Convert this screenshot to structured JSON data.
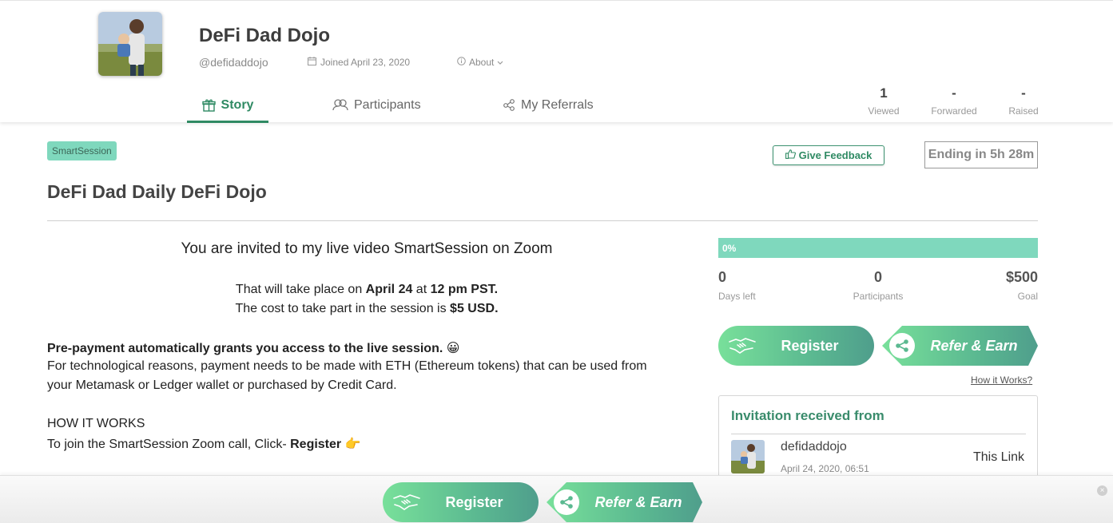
{
  "profile": {
    "name": "DeFi Dad Dojo",
    "handle": "@defidaddojo",
    "joined": "Joined April 23, 2020",
    "about": "About"
  },
  "tabs": [
    {
      "label": "Story",
      "icon": "gift-icon",
      "active": true
    },
    {
      "label": "Participants",
      "icon": "people-icon",
      "active": false
    },
    {
      "label": "My Referrals",
      "icon": "share-nodes-icon",
      "active": false
    }
  ],
  "stats": [
    {
      "value": "1",
      "label": "Viewed"
    },
    {
      "value": "-",
      "label": "Forwarded"
    },
    {
      "value": "-",
      "label": "Raised"
    }
  ],
  "session": {
    "badge": "SmartSession",
    "feedback_label": "Give Feedback",
    "ending": "Ending in 5h 28m",
    "title": "DeFi Dad Daily DeFi Dojo"
  },
  "story": {
    "heading": "You are invited to my live video SmartSession on Zoom",
    "line1_a": "That will take place on ",
    "line1_b": "April 24",
    "line1_c": " at ",
    "line1_d": "12 pm PST.",
    "line2_a": "The cost to take part in the session is ",
    "line2_b": "$5 USD.",
    "prepay": "Pre-payment automatically grants you access to the live session.",
    "prepay_emoji": "😀",
    "tech1": "For technological reasons, payment needs to be made with ETH (Ethereum tokens) that can be used from",
    "tech2": "your Metamask or Ledger wallet or purchased by Credit Card.",
    "how_heading": "HOW IT WORKS",
    "join_a": "To join the SmartSession Zoom call, Click- ",
    "join_b": "Register",
    "join_emoji": "👉"
  },
  "progress": {
    "label": "0%",
    "fraction": 0,
    "days_left": "0",
    "days_left_label": "Days left",
    "participants": "0",
    "participants_label": "Participants",
    "goal": "$500",
    "goal_label": "Goal"
  },
  "actions": {
    "register": "Register",
    "refer": "Refer & Earn",
    "how": "How it Works?"
  },
  "invitation": {
    "title": "Invitation received from",
    "user": "defidaddojo",
    "date": "April 24, 2020, 06:51",
    "link": "This Link"
  },
  "colors": {
    "accent": "#2f8a63",
    "progress": "#7fd8bd",
    "button_start": "#78e09a",
    "button_end": "#4f9e8c"
  }
}
